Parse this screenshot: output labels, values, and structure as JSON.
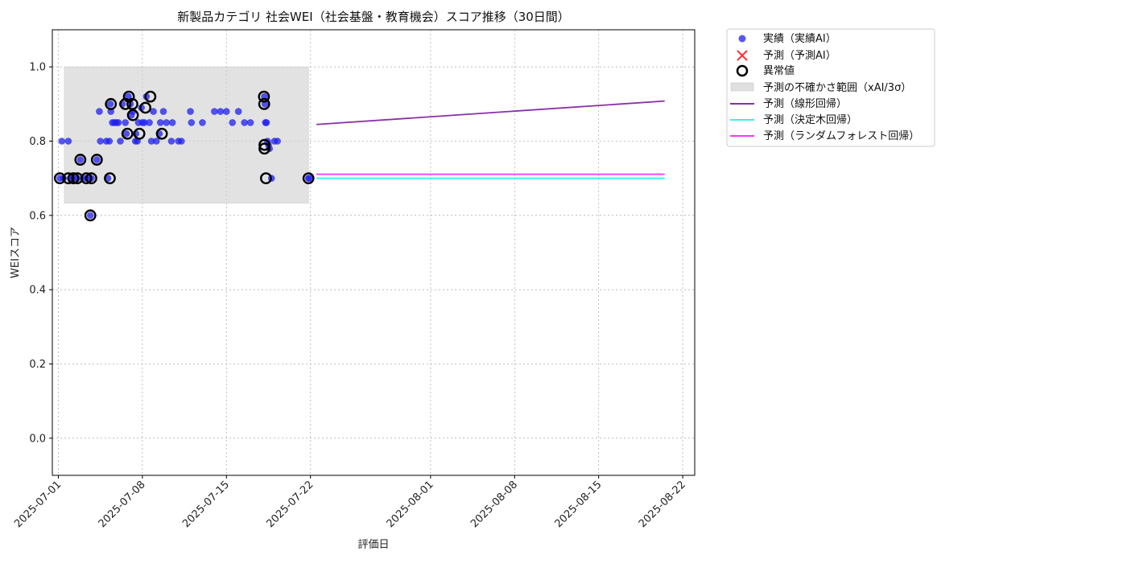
{
  "chart_data": {
    "type": "scatter",
    "title": "新製品カテゴリ 社会WEI（社会基盤・教育機会）スコア推移（30日間）",
    "xlabel": "評価日",
    "ylabel": "WEIスコア",
    "xlim": [
      "2025-06-30T12:00",
      "2025-08-23T00:00"
    ],
    "ylim": [
      -0.1,
      1.1
    ],
    "y_ticks": [
      0.0,
      0.2,
      0.4,
      0.6,
      0.8,
      1.0
    ],
    "y_tick_labels": [
      "0.0",
      "0.2",
      "0.4",
      "0.6",
      "0.8",
      "1.0"
    ],
    "x_ticks": [
      "2025-07-01",
      "2025-07-08",
      "2025-07-15",
      "2025-07-22",
      "2025-08-01",
      "2025-08-08",
      "2025-08-15",
      "2025-08-22"
    ],
    "x_tick_labels": [
      "2025-07-01",
      "2025-07-08",
      "2025-07-15",
      "2025-07-22",
      "2025-08-01",
      "2025-08-08",
      "2025-08-15",
      "2025-08-22"
    ],
    "grid": true,
    "legend_position": "outside-top-right",
    "colors": {
      "actual": "#1f1fee",
      "predicted": "#ff3333",
      "anomaly_edge": "#000000",
      "band": "#d3d3d3",
      "linear": "#8b2fa8",
      "tree": "#33f0f0",
      "forest": "#ff33ff"
    },
    "uncertainty_band": {
      "label": "予測の不確かさ範囲（xAI/3σ）",
      "x_start": "2025-07-01T12:00",
      "x_end": "2025-07-21T20:00",
      "y_low": 0.633,
      "y_high": 1.0
    },
    "series": [
      {
        "name": "実績（実績AI）",
        "kind": "scatter",
        "points": [
          [
            "2025-07-01T03:00",
            0.7
          ],
          [
            "2025-07-01T10:00",
            0.7
          ],
          [
            "2025-07-01T07:00",
            0.8
          ],
          [
            "2025-07-01T20:00",
            0.8
          ],
          [
            "2025-07-02T00:00",
            0.7
          ],
          [
            "2025-07-02T06:00",
            0.7
          ],
          [
            "2025-07-02T14:00",
            0.7
          ],
          [
            "2025-07-02T20:00",
            0.75
          ],
          [
            "2025-07-03T04:00",
            0.7
          ],
          [
            "2025-07-03T10:00",
            0.7
          ],
          [
            "2025-07-03T16:00",
            0.6
          ],
          [
            "2025-07-03T18:00",
            0.7
          ],
          [
            "2025-07-04T05:00",
            0.75
          ],
          [
            "2025-07-04T10:00",
            0.88
          ],
          [
            "2025-07-04T12:00",
            0.8
          ],
          [
            "2025-07-05T00:00",
            0.8
          ],
          [
            "2025-07-05T03:00",
            0.7
          ],
          [
            "2025-07-05T06:00",
            0.8
          ],
          [
            "2025-07-05T08:00",
            0.9
          ],
          [
            "2025-07-05T09:00",
            0.88
          ],
          [
            "2025-07-05T12:00",
            0.85
          ],
          [
            "2025-07-05T16:00",
            0.85
          ],
          [
            "2025-07-05T20:00",
            0.85
          ],
          [
            "2025-07-06T00:00",
            0.85
          ],
          [
            "2025-07-06T04:00",
            0.8
          ],
          [
            "2025-07-06T08:00",
            0.9
          ],
          [
            "2025-07-06T14:00",
            0.85
          ],
          [
            "2025-07-06T16:00",
            0.82
          ],
          [
            "2025-07-06T20:00",
            0.92
          ],
          [
            "2025-07-07T00:00",
            0.9
          ],
          [
            "2025-07-07T02:00",
            0.87
          ],
          [
            "2025-07-07T05:00",
            0.88
          ],
          [
            "2025-07-07T10:00",
            0.8
          ],
          [
            "2025-07-07T11:00",
            0.82
          ],
          [
            "2025-07-07T14:00",
            0.8
          ],
          [
            "2025-07-07T16:00",
            0.85
          ],
          [
            "2025-07-07T22:00",
            0.89
          ],
          [
            "2025-07-08T00:00",
            0.85
          ],
          [
            "2025-07-08T04:00",
            0.85
          ],
          [
            "2025-07-08T08:00",
            0.92
          ],
          [
            "2025-07-08T14:00",
            0.85
          ],
          [
            "2025-07-08T18:00",
            0.8
          ],
          [
            "2025-07-08T22:00",
            0.88
          ],
          [
            "2025-07-09T04:00",
            0.8
          ],
          [
            "2025-07-09T10:00",
            0.82
          ],
          [
            "2025-07-09T12:00",
            0.85
          ],
          [
            "2025-07-09T18:00",
            0.88
          ],
          [
            "2025-07-10T00:00",
            0.85
          ],
          [
            "2025-07-10T10:00",
            0.8
          ],
          [
            "2025-07-10T12:00",
            0.85
          ],
          [
            "2025-07-11T00:00",
            0.8
          ],
          [
            "2025-07-11T06:00",
            0.8
          ],
          [
            "2025-07-12T00:00",
            0.88
          ],
          [
            "2025-07-12T02:00",
            0.85
          ],
          [
            "2025-07-13T00:00",
            0.85
          ],
          [
            "2025-07-14T00:00",
            0.88
          ],
          [
            "2025-07-14T12:00",
            0.88
          ],
          [
            "2025-07-15T00:00",
            0.88
          ],
          [
            "2025-07-15T12:00",
            0.85
          ],
          [
            "2025-07-16T00:00",
            0.88
          ],
          [
            "2025-07-16T12:00",
            0.85
          ],
          [
            "2025-07-17T00:00",
            0.85
          ],
          [
            "2025-07-18T04:00",
            0.92
          ],
          [
            "2025-07-18T05:00",
            0.9
          ],
          [
            "2025-07-18T06:00",
            0.85
          ],
          [
            "2025-07-18T08:00",
            0.85
          ],
          [
            "2025-07-18T10:00",
            0.8
          ],
          [
            "2025-07-18T12:00",
            0.79
          ],
          [
            "2025-07-18T14:00",
            0.78
          ],
          [
            "2025-07-18T18:00",
            0.7
          ],
          [
            "2025-07-19T00:00",
            0.8
          ],
          [
            "2025-07-19T06:00",
            0.8
          ],
          [
            "2025-07-21T20:00",
            0.7
          ],
          [
            "2025-07-21T22:00",
            0.7
          ]
        ]
      },
      {
        "name": "予測（予測AI）",
        "kind": "marker-x",
        "points": []
      },
      {
        "name": "異常値",
        "kind": "ring",
        "points": [
          [
            "2025-07-01T03:00",
            0.7
          ],
          [
            "2025-07-01T20:00",
            0.7
          ],
          [
            "2025-07-02T06:00",
            0.7
          ],
          [
            "2025-07-02T14:00",
            0.7
          ],
          [
            "2025-07-02T20:00",
            0.75
          ],
          [
            "2025-07-03T08:00",
            0.7
          ],
          [
            "2025-07-03T16:00",
            0.6
          ],
          [
            "2025-07-03T18:00",
            0.7
          ],
          [
            "2025-07-04T05:00",
            0.75
          ],
          [
            "2025-07-05T07:00",
            0.7
          ],
          [
            "2025-07-05T09:00",
            0.9
          ],
          [
            "2025-07-06T14:00",
            0.9
          ],
          [
            "2025-07-06T18:00",
            0.82
          ],
          [
            "2025-07-06T21:00",
            0.92
          ],
          [
            "2025-07-07T04:00",
            0.9
          ],
          [
            "2025-07-07T05:00",
            0.87
          ],
          [
            "2025-07-07T18:00",
            0.82
          ],
          [
            "2025-07-08T06:00",
            0.89
          ],
          [
            "2025-07-08T16:00",
            0.92
          ],
          [
            "2025-07-09T15:00",
            0.82
          ],
          [
            "2025-07-18T03:00",
            0.92
          ],
          [
            "2025-07-18T03:30",
            0.9
          ],
          [
            "2025-07-18T04:00",
            0.79
          ],
          [
            "2025-07-18T04:00",
            0.78
          ],
          [
            "2025-07-18T07:00",
            0.7
          ],
          [
            "2025-07-21T20:00",
            0.7
          ]
        ]
      },
      {
        "name": "予測（線形回帰）",
        "kind": "line",
        "points": [
          [
            "2025-07-22T12:00",
            0.845
          ],
          [
            "2025-08-20T12:00",
            0.908
          ]
        ]
      },
      {
        "name": "予測（決定木回帰）",
        "kind": "line",
        "points": [
          [
            "2025-07-22T12:00",
            0.7
          ],
          [
            "2025-08-20T12:00",
            0.7
          ]
        ]
      },
      {
        "name": "予測（ランダムフォレスト回帰）",
        "kind": "line",
        "points": [
          [
            "2025-07-22T12:00",
            0.711
          ],
          [
            "2025-08-20T12:00",
            0.711
          ]
        ]
      }
    ]
  }
}
